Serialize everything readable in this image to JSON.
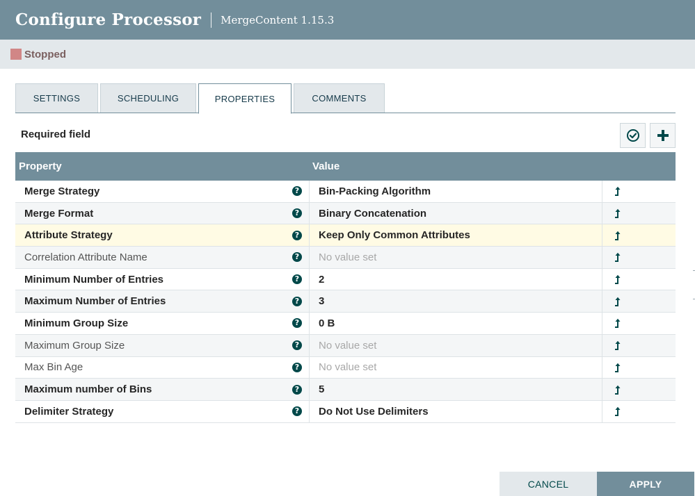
{
  "header": {
    "title": "Configure Processor",
    "subtitle": "MergeContent 1.15.3"
  },
  "status": {
    "icon": "stopped-square-icon",
    "text": "Stopped",
    "color": "#d18686"
  },
  "tabs": [
    {
      "label": "SETTINGS",
      "active": false
    },
    {
      "label": "SCHEDULING",
      "active": false
    },
    {
      "label": "PROPERTIES",
      "active": true
    },
    {
      "label": "COMMENTS",
      "active": false
    }
  ],
  "properties_panel": {
    "required_label": "Required field",
    "verify_icon": "check-circle-icon",
    "add_icon": "plus-icon"
  },
  "grid": {
    "columns": {
      "property": "Property",
      "value": "Value"
    },
    "rows": [
      {
        "name": "Merge Strategy",
        "required": true,
        "value": "Bin-Packing Algorithm",
        "empty": false
      },
      {
        "name": "Merge Format",
        "required": true,
        "value": "Binary Concatenation",
        "empty": false
      },
      {
        "name": "Attribute Strategy",
        "required": true,
        "value": "Keep Only Common Attributes",
        "empty": false,
        "selected": true
      },
      {
        "name": "Correlation Attribute Name",
        "required": false,
        "value": "No value set",
        "empty": true
      },
      {
        "name": "Minimum Number of Entries",
        "required": true,
        "value": "2",
        "empty": false
      },
      {
        "name": "Maximum Number of Entries",
        "required": true,
        "value": "3",
        "empty": false
      },
      {
        "name": "Minimum Group Size",
        "required": true,
        "value": "0 B",
        "empty": false
      },
      {
        "name": "Maximum Group Size",
        "required": false,
        "value": "No value set",
        "empty": true
      },
      {
        "name": "Max Bin Age",
        "required": false,
        "value": "No value set",
        "empty": true
      },
      {
        "name": "Maximum number of Bins",
        "required": true,
        "value": "5",
        "empty": false
      },
      {
        "name": "Delimiter Strategy",
        "required": true,
        "value": "Do Not Use Delimiters",
        "empty": false
      }
    ],
    "help_icon": "question-circle-icon",
    "action_icon": "goto-service-arrow-icon"
  },
  "footer": {
    "cancel_label": "CANCEL",
    "apply_label": "APPLY"
  },
  "colors": {
    "header_bg": "#728e9b",
    "accent_dark": "#004849",
    "selected_row": "#fffbe4"
  }
}
